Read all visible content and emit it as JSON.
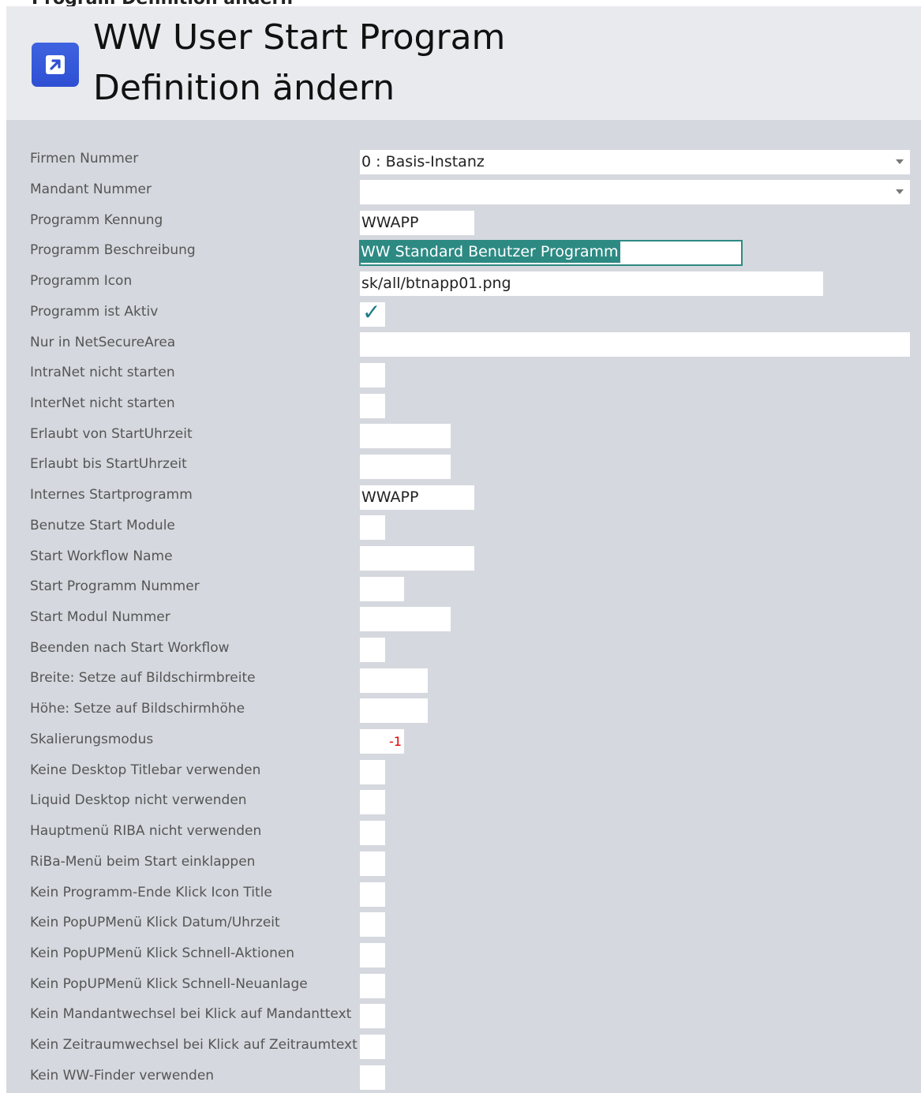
{
  "page": {
    "cut_title": "Program Definition ändern",
    "title_line1": "WW User Start Program",
    "title_line2": "Definition ändern"
  },
  "icons": {
    "app_icon": "arrow-up-right-icon",
    "dropdown": "chevron-down-icon",
    "check": "check-icon"
  },
  "colors": {
    "accent": "#2d8a83",
    "app_icon": "#3453d9",
    "check": "#1e7a88",
    "error_red": "#e00000"
  },
  "form": {
    "labels": [
      "Firmen Nummer",
      "Mandant Nummer",
      "Programm Kennung",
      "Programm Beschreibung",
      "Programm Icon",
      "Programm ist Aktiv",
      "Nur in NetSecureArea",
      "IntraNet nicht starten",
      "InterNet nicht starten",
      "Erlaubt von StartUhrzeit",
      "Erlaubt bis StartUhrzeit",
      "Internes Startprogramm",
      "Benutze Start Module",
      "Start Workflow Name",
      "Start Programm Nummer",
      "Start Modul Nummer",
      "Beenden nach Start Workflow",
      "Breite: Setze auf Bildschirmbreite",
      "Höhe: Setze auf Bildschirmhöhe",
      "Skalierungsmodus",
      "Keine Desktop Titlebar verwenden",
      "Liquid Desktop nicht verwenden",
      "Hauptmenü RIBA nicht verwenden",
      "RiBa-Menü beim Start einklappen",
      "Kein Programm-Ende Klick Icon Title",
      "Kein PopUPMenü Klick Datum/Uhrzeit",
      "Kein PopUPMenü Klick Schnell-Aktionen",
      "Kein PopUPMenü Klick Schnell-Neuanlage",
      "Kein Mandantwechsel bei Klick auf Mandanttext",
      "Kein Zeitraumwechsel bei Klick auf Zeitraumtext",
      "Kein WW-Finder verwenden"
    ],
    "values": {
      "firmen_nummer": "0 : Basis-Instanz",
      "mandant_nummer": "",
      "programm_kennung": "WWAPP",
      "programm_beschreibung": "WW Standard Benutzer Programm",
      "programm_icon": "sk/all/btnapp01.png",
      "programm_ist_aktiv": true,
      "nur_in_netsecurearea": "",
      "erlaubt_von": "",
      "erlaubt_bis": "",
      "internes_startprogramm": "WWAPP",
      "start_workflow_name": "",
      "start_programm_nummer": "",
      "start_modul_nummer": "",
      "breite": "",
      "hoehe": "",
      "skalierungsmodus": "-1"
    }
  }
}
